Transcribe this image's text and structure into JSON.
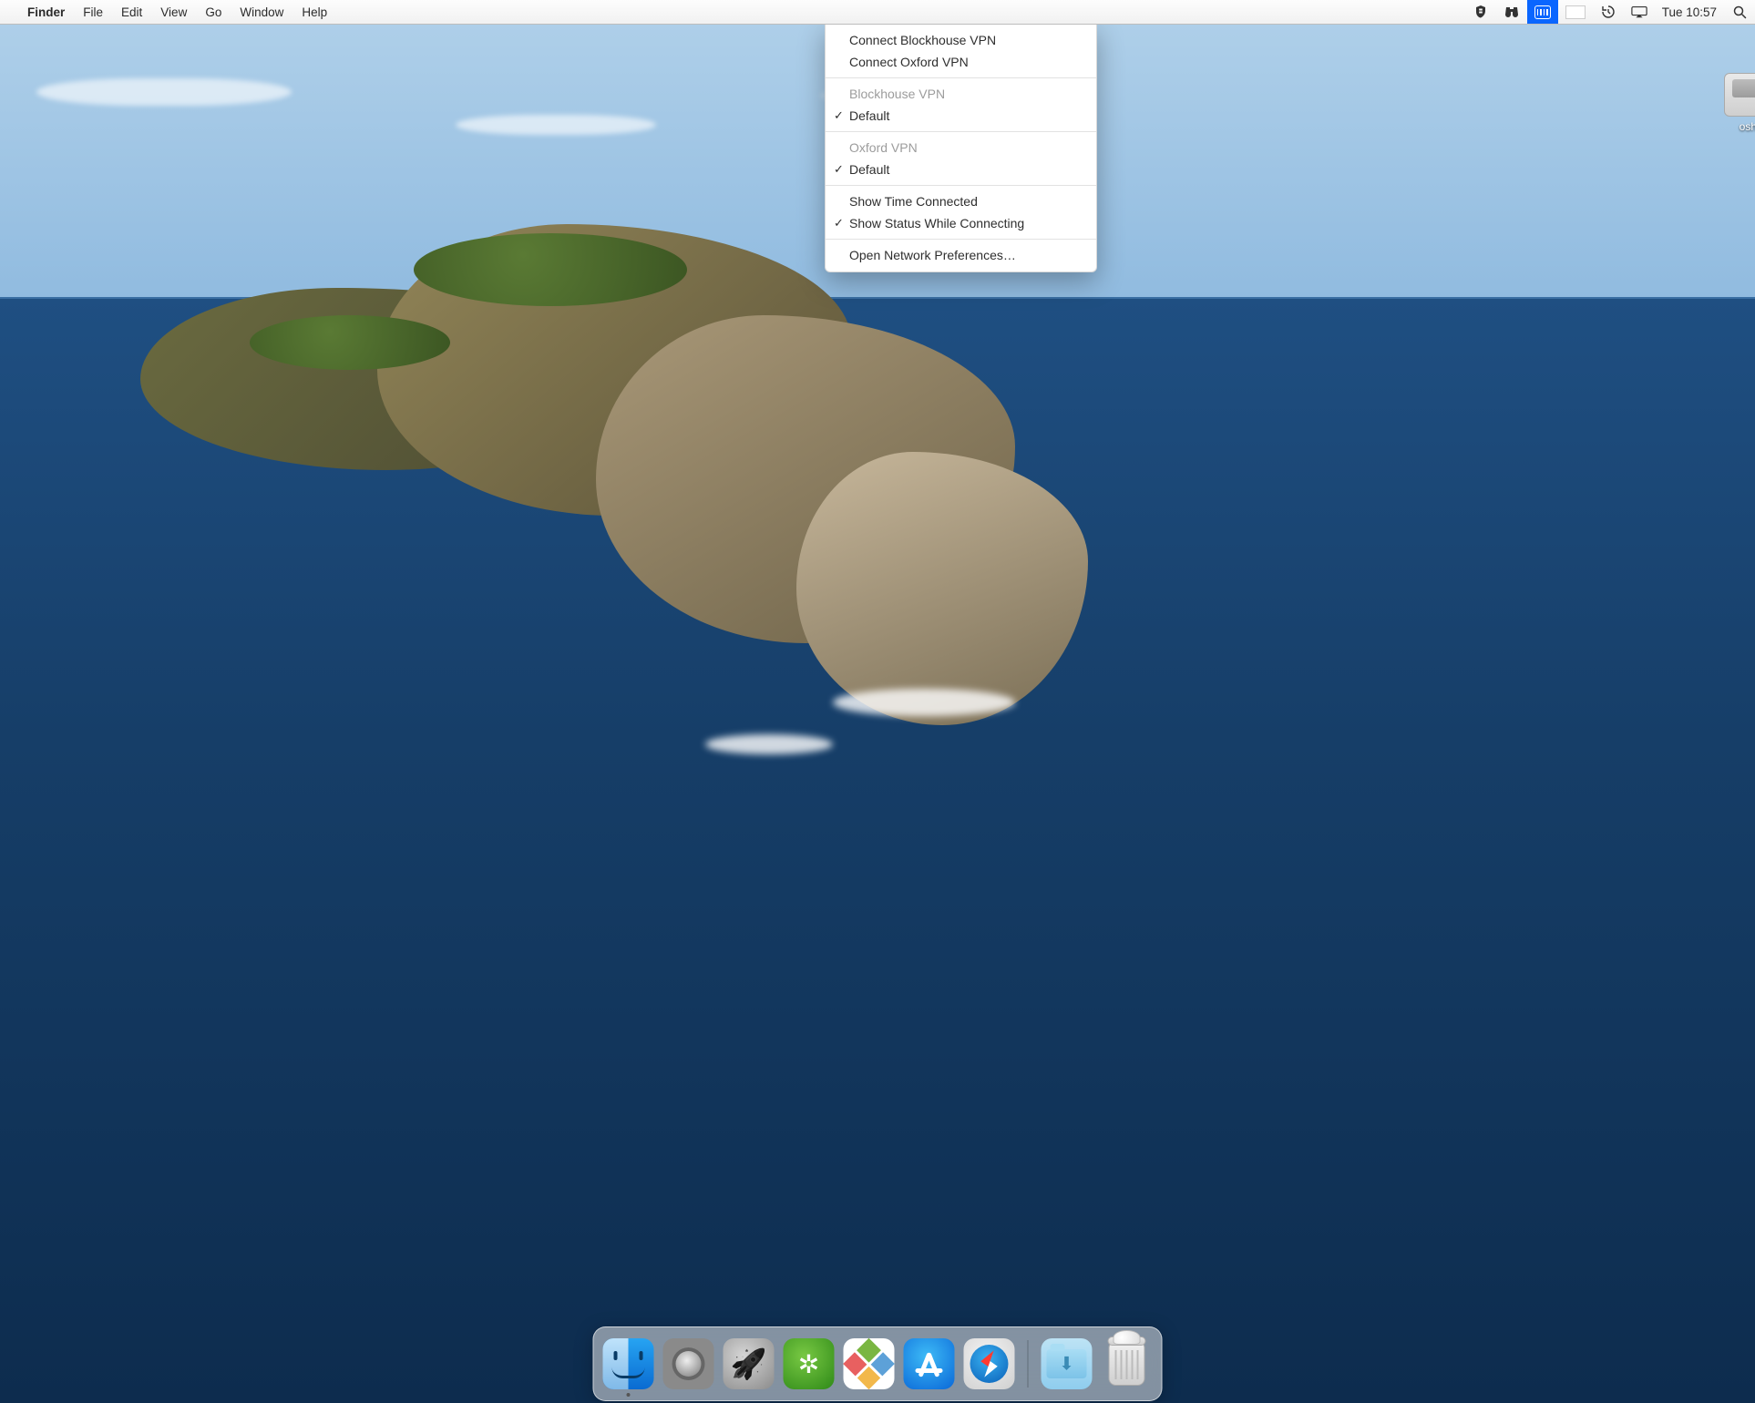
{
  "menubar": {
    "app": "Finder",
    "items": [
      "File",
      "Edit",
      "View",
      "Go",
      "Window",
      "Help"
    ],
    "clock": "Tue 10:57"
  },
  "status_icons": {
    "shield": "shield-icon",
    "binoculars": "binoculars-icon",
    "vpn": "vpn-icon",
    "flag": "uk-flag-icon",
    "timemachine": "timemachine-icon",
    "airplay": "airplay-icon",
    "spotlight": "spotlight-icon"
  },
  "dropdown": {
    "connect": [
      "Connect Blockhouse VPN",
      "Connect Oxford VPN"
    ],
    "groups": [
      {
        "header": "Blockhouse VPN",
        "items": [
          {
            "label": "Default",
            "checked": true
          }
        ]
      },
      {
        "header": "Oxford VPN",
        "items": [
          {
            "label": "Default",
            "checked": true
          }
        ]
      }
    ],
    "options": [
      {
        "label": "Show Time Connected",
        "checked": false
      },
      {
        "label": "Show Status While Connecting",
        "checked": true
      }
    ],
    "footer": "Open Network Preferences…"
  },
  "desktop": {
    "disk_label": "osh"
  },
  "dock": {
    "apps": [
      {
        "id": "finder",
        "name": "Finder",
        "running": true
      },
      {
        "id": "pref",
        "name": "System Preferences",
        "running": false
      },
      {
        "id": "launch",
        "name": "Launchpad",
        "running": false
      },
      {
        "id": "green",
        "name": "App",
        "running": false
      },
      {
        "id": "citrix",
        "name": "Citrix",
        "running": false
      },
      {
        "id": "appstore",
        "name": "App Store",
        "running": false
      },
      {
        "id": "safari",
        "name": "Safari",
        "running": false
      }
    ],
    "right": [
      {
        "id": "dl",
        "name": "Downloads"
      },
      {
        "id": "trash",
        "name": "Trash"
      }
    ]
  }
}
